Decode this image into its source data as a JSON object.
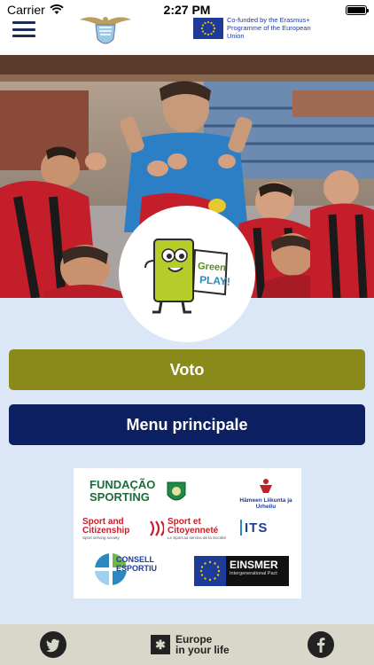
{
  "status_bar": {
    "carrier": "Carrier",
    "time": "2:27 PM"
  },
  "header": {
    "eu_text": "Co-funded by the Erasmus+ Programme of the European Union"
  },
  "buttons": {
    "voto": "Voto",
    "menu": "Menu principale"
  },
  "partners": {
    "fundacao": "FUNDAÇÃO SPORTING",
    "hameen": "Hämeen Liikunta ja Urheilu",
    "sport_citizenship": "Sport and Citizenship",
    "sport_citizenship_sub": "Sport serving society",
    "sport_citoyennete": "Sport et Citoyenneté",
    "sport_citoyennete_sub": "Le Sport au service de la Société",
    "its": "ITS",
    "consell": "CONSELL ESPORTIU",
    "einsmer": "EINSMER",
    "einsmer_sub": "Intergenerational Pact"
  },
  "footer": {
    "eyl_line1": "Europe",
    "eyl_line2": "in your life"
  },
  "colors": {
    "voto": "#8a8a1a",
    "menu": "#0c1f60",
    "background": "#dbe6f6",
    "footer": "#d8d7c9"
  }
}
